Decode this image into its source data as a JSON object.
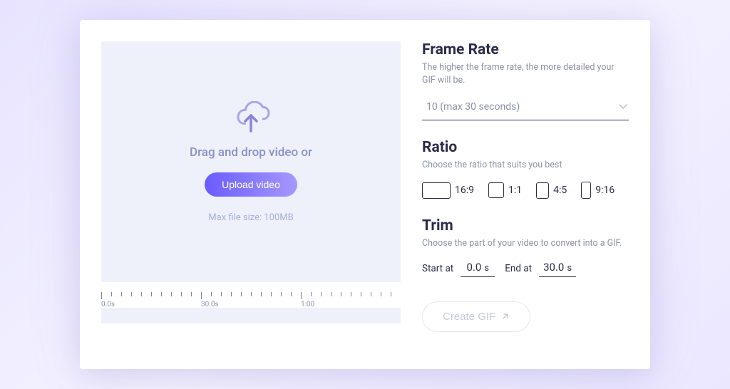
{
  "upload": {
    "drop_text": "Drag and drop video or",
    "button_label": "Upload video",
    "max_size_text": "Max file size: 100MB"
  },
  "timeline": {
    "labels": [
      "0.0s",
      "30.0s",
      "1:00"
    ]
  },
  "frame_rate": {
    "title": "Frame Rate",
    "desc": "The higher the frame rate, the more detailed your GIF will be.",
    "selected": "10 (max 30 seconds)"
  },
  "ratio": {
    "title": "Ratio",
    "desc": "Choose the ratio that suits you best",
    "options": [
      {
        "label": "16:9"
      },
      {
        "label": "1:1"
      },
      {
        "label": "4:5"
      },
      {
        "label": "9:16"
      }
    ]
  },
  "trim": {
    "title": "Trim",
    "desc": "Choose the part of your video to convert into a GIF.",
    "start_label": "Start at",
    "start_value": "0.0",
    "end_label": "End at",
    "end_value": "30.0",
    "unit": "s"
  },
  "create": {
    "label": "Create GIF"
  }
}
